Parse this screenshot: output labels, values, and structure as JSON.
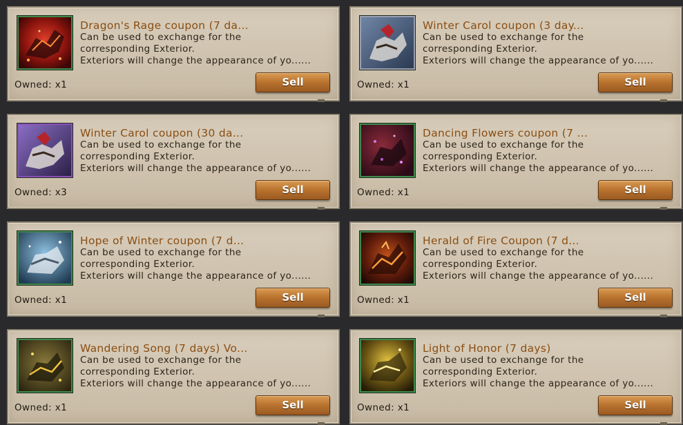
{
  "items": [
    {
      "title": "Dragon's Rage coupon (7 da...",
      "desc": [
        "Can be used to exchange for the",
        "corresponding Exterior.",
        "Exteriors will change the appearance of yo......"
      ],
      "owned": "Owned: x1",
      "sell_label": "Sell",
      "icon": "dragons-rage-mount-icon",
      "frame_color": "#3f8a4c"
    },
    {
      "title": "Winter Carol coupon (3 day...",
      "desc": [
        "Can be used to exchange for the",
        "corresponding Exterior.",
        "Exteriors will change the appearance of yo......"
      ],
      "owned": "Owned: x1",
      "sell_label": "Sell",
      "icon": "winter-carol-mount-icon",
      "frame_color": "#9a9fb0"
    },
    {
      "title": "Winter Carol coupon (30 da...",
      "desc": [
        "Can be used to exchange for the",
        "corresponding Exterior.",
        "Exteriors will change the appearance of yo......"
      ],
      "owned": "Owned: x3",
      "sell_label": "Sell",
      "icon": "winter-carol-mount-icon",
      "frame_color": "#8b4fb8"
    },
    {
      "title": "Dancing Flowers coupon (7 ...",
      "desc": [
        "Can be used to exchange for the",
        "corresponding Exterior.",
        "Exteriors will change the appearance of yo......"
      ],
      "owned": "Owned: x1",
      "sell_label": "Sell",
      "icon": "dancing-flowers-mount-icon",
      "frame_color": "#3f8a4c"
    },
    {
      "title": "Hope of Winter coupon (7 d...",
      "desc": [
        "Can be used to exchange for the",
        "corresponding Exterior.",
        "Exteriors will change the appearance of yo......"
      ],
      "owned": "Owned: x1",
      "sell_label": "Sell",
      "icon": "hope-of-winter-mount-icon",
      "frame_color": "#3f8a4c"
    },
    {
      "title": "Herald of Fire Coupon (7 d...",
      "desc": [
        "Can be used to exchange for the",
        "corresponding Exterior.",
        "Exteriors will change the appearance of yo......"
      ],
      "owned": "Owned: x1",
      "sell_label": "Sell",
      "icon": "herald-of-fire-mount-icon",
      "frame_color": "#3f8a4c"
    },
    {
      "title": "Wandering Song (7 days) Vo...",
      "desc": [
        "Can be used to exchange for the",
        "corresponding Exterior.",
        "Exteriors will change the appearance of yo......"
      ],
      "owned": "Owned: x1",
      "sell_label": "Sell",
      "icon": "wandering-song-mount-icon",
      "frame_color": "#3f8a4c"
    },
    {
      "title": "Light of Honor  (7 days)",
      "desc": [
        "Can be used to exchange for the",
        "corresponding Exterior.",
        "Exteriors will change the appearance of yo......"
      ],
      "owned": "Owned: x1",
      "sell_label": "Sell",
      "icon": "light-of-honor-mount-icon",
      "frame_color": "#3f8a4c"
    }
  ]
}
